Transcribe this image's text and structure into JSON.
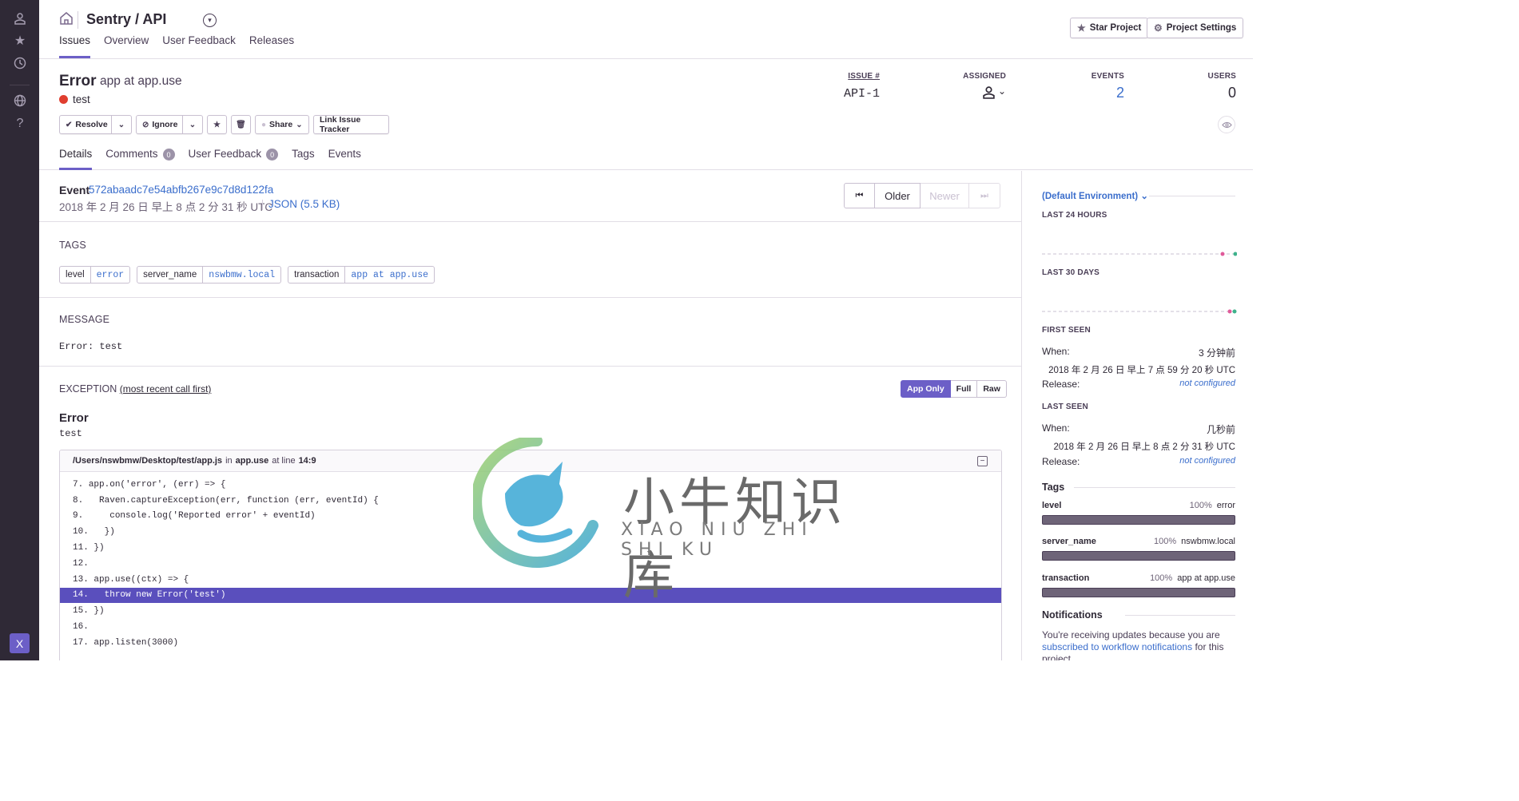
{
  "rail": {
    "org_initial": "X"
  },
  "header": {
    "project_title": "Sentry / API",
    "nav_tabs": [
      "Issues",
      "Overview",
      "User Feedback",
      "Releases"
    ],
    "star_label": "Star Project",
    "settings_label": "Project Settings"
  },
  "issue": {
    "type": "Error",
    "culprit": "app at app.use",
    "message": "test",
    "status_color": "#e03e2f",
    "actions": {
      "resolve": "Resolve",
      "ignore": "Ignore",
      "share": "Share",
      "link_tracker": "Link Issue Tracker"
    },
    "stats": {
      "issue_label": "ISSUE #",
      "issue_value": "API-1",
      "assigned_label": "ASSIGNED",
      "events_label": "EVENTS",
      "events_value": "2",
      "users_label": "USERS",
      "users_value": "0"
    },
    "tabs": [
      {
        "label": "Details"
      },
      {
        "label": "Comments",
        "badge": "0"
      },
      {
        "label": "User Feedback",
        "badge": "0"
      },
      {
        "label": "Tags"
      },
      {
        "label": "Events"
      }
    ]
  },
  "event": {
    "label": "Event",
    "id": "572abaadc7e54abfb267e9c7d8d122fa",
    "date": "2018 年 2 月 26 日 早上 8 点 2 分 31 秒 UTC",
    "json_link": "JSON (5.5 KB)",
    "pager": {
      "first": "K",
      "older": "Older",
      "newer": "Newer",
      "last": "K"
    }
  },
  "tags_section": {
    "title": "TAGS",
    "tags": [
      {
        "key": "level",
        "value": "error"
      },
      {
        "key": "server_name",
        "value": "nswbmw.local"
      },
      {
        "key": "transaction",
        "value": "app at app.use"
      }
    ]
  },
  "message_section": {
    "title": "MESSAGE",
    "text": "Error: test"
  },
  "exception": {
    "title": "EXCEPTION",
    "note": "(most recent call first)",
    "toggle": [
      "App Only",
      "Full",
      "Raw"
    ],
    "type": "Error",
    "value": "test",
    "frame": {
      "path": "/Users/nswbmw/Desktop/test/app.js",
      "in_word": "in",
      "function": "app.use",
      "at_line_word": "at line",
      "line": "14:9",
      "highlight_line": 14,
      "lines": [
        {
          "no": "7.",
          "code": "app.on('error', (err) => {"
        },
        {
          "no": "8.",
          "code": "  Raven.captureException(err, function (err, eventId) {"
        },
        {
          "no": "9.",
          "code": "    console.log('Reported error' + eventId)"
        },
        {
          "no": "10.",
          "code": "  })"
        },
        {
          "no": "11.",
          "code": "})"
        },
        {
          "no": "12.",
          "code": ""
        },
        {
          "no": "13.",
          "code": "app.use((ctx) => {"
        },
        {
          "no": "14.",
          "code": "  throw new Error('test')"
        },
        {
          "no": "15.",
          "code": "})"
        },
        {
          "no": "16.",
          "code": ""
        },
        {
          "no": "17.",
          "code": "app.listen(3000)"
        }
      ]
    }
  },
  "watermark": {
    "text": "小牛知识库",
    "sub": "XIAO NIU ZHI SHI KU"
  },
  "sidebar": {
    "environment": "(Default Environment)",
    "last_24h": "LAST 24 HOURS",
    "last_30d": "LAST 30 DAYS",
    "first_seen": {
      "title": "FIRST SEEN",
      "when_label": "When:",
      "when_value": "3 分钟前",
      "date": "2018 年 2 月 26 日 早上 7 点 59 分 20 秒 UTC",
      "release_label": "Release:",
      "release_value": "not configured"
    },
    "last_seen": {
      "title": "LAST SEEN",
      "when_label": "When:",
      "when_value": "几秒前",
      "date": "2018 年 2 月 26 日 早上 8 点 2 分 31 秒 UTC",
      "release_label": "Release:",
      "release_value": "not configured"
    },
    "tags_title": "Tags",
    "tag_stats": [
      {
        "name": "level",
        "percent": "100%",
        "value": "error"
      },
      {
        "name": "server_name",
        "percent": "100%",
        "value": "nswbmw.local"
      },
      {
        "name": "transaction",
        "percent": "100%",
        "value": "app at app.use"
      }
    ],
    "notifications": {
      "title": "Notifications",
      "text_before": "You're receiving updates because you are",
      "link": "subscribed to workflow notifications",
      "text_after": "for this project."
    }
  }
}
